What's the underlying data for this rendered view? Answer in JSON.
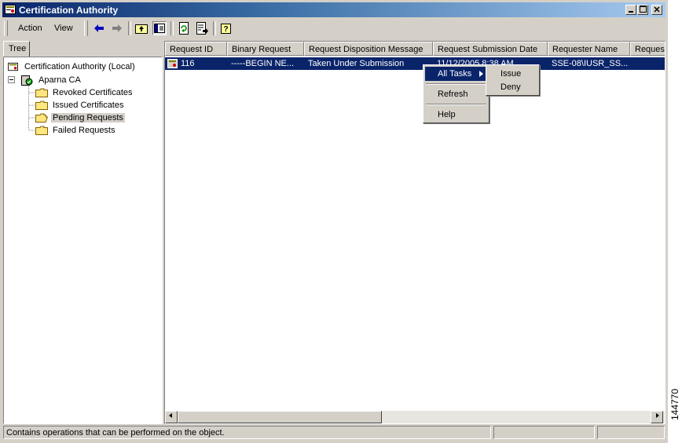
{
  "window": {
    "title": "Certification Authority",
    "controls": [
      "minimize",
      "maximize",
      "close"
    ]
  },
  "menubar": {
    "items": [
      {
        "label": "Action"
      },
      {
        "label": "View"
      }
    ]
  },
  "toolbar": {
    "icons": [
      "back-arrow-icon",
      "forward-arrow-icon",
      "up-folder-icon",
      "show-hide-tree-icon",
      "refresh-icon",
      "export-list-icon",
      "help-icon"
    ]
  },
  "tree": {
    "tab_label": "Tree",
    "root": "Certification Authority (Local)",
    "ca": "Aparna CA",
    "folders": [
      "Revoked Certificates",
      "Issued Certificates",
      "Pending Requests",
      "Failed Requests"
    ],
    "selected": "Pending Requests"
  },
  "list": {
    "columns": [
      "Request ID",
      "Binary Request",
      "Request Disposition Message",
      "Request Submission Date",
      "Requester Name",
      "Reques"
    ],
    "rows": [
      {
        "request_id": "116",
        "binary_request": "-----BEGIN NE...",
        "disposition": "Taken Under Submission",
        "submission_date": "11/12/2005 8:38 AM",
        "requester": "SSE-08\\IUSR_SS..."
      }
    ]
  },
  "context_menu": {
    "items": [
      "All Tasks",
      "Refresh",
      "Help"
    ],
    "submenu": [
      "Issue",
      "Deny"
    ]
  },
  "statusbar": {
    "text": "Contains operations that can be performed on the object."
  },
  "figure_id": "144770",
  "colors": {
    "selection": "#0a246a",
    "face": "#d4d0c8"
  }
}
